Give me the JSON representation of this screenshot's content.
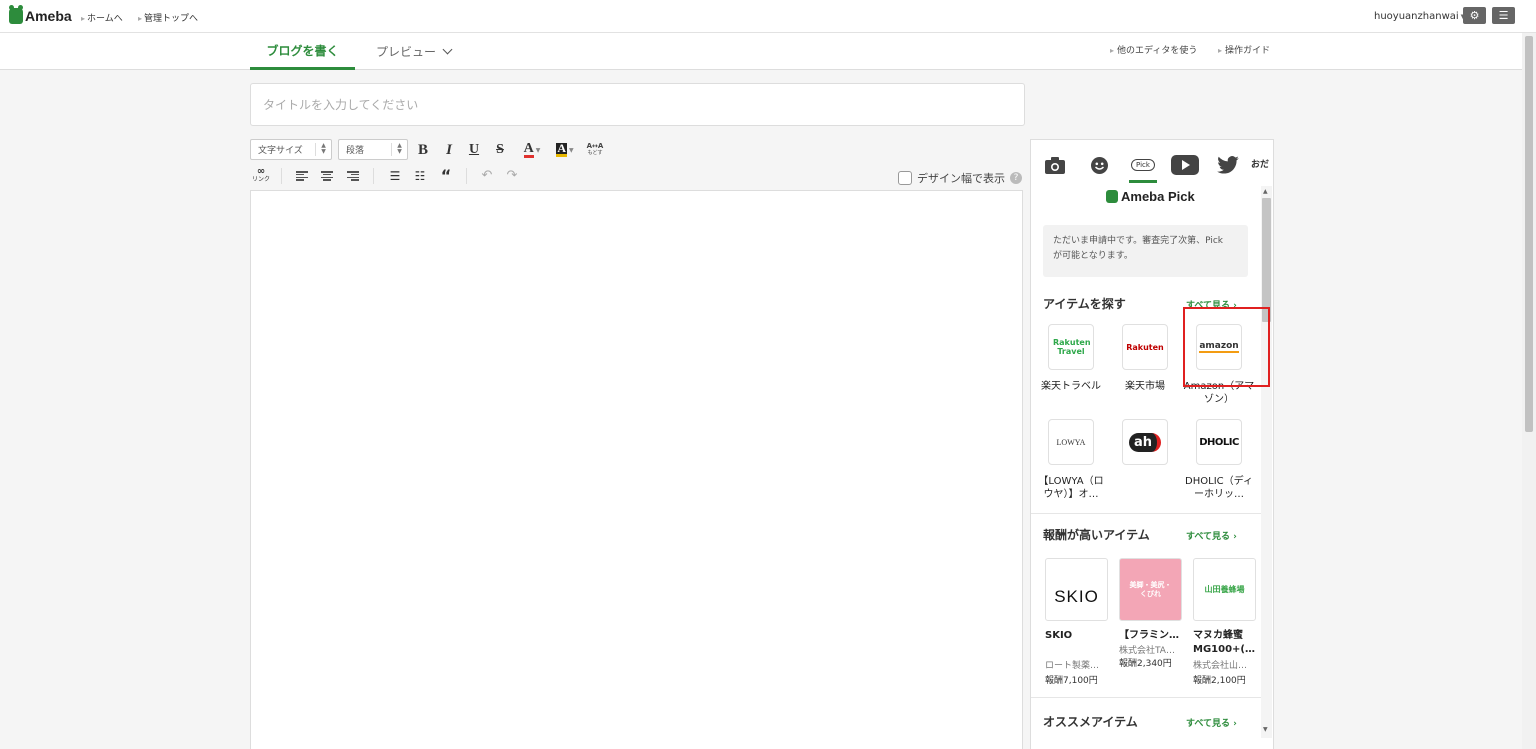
{
  "topbar": {
    "logo": "Ameba",
    "links": [
      "ホームへ",
      "管理トップへ"
    ],
    "username": "huoyuanzhanwai"
  },
  "tabs": {
    "write": "ブログを書く",
    "preview": "プレビュー",
    "right_links": [
      "他のエディタを使う",
      "操作ガイド"
    ]
  },
  "title_input": {
    "placeholder": "タイトルを入力してください",
    "value": ""
  },
  "toolbar": {
    "font_size": "文字サイズ",
    "paragraph": "段落",
    "bold": "B",
    "italic": "I",
    "underline": "U",
    "strike": "S",
    "font_color": "A",
    "bg_color": "A",
    "link_label": "リンク",
    "design_width": "デザイン幅で表示"
  },
  "colors": {
    "accent": "#2d8c3c",
    "highlight": "#e02020"
  },
  "panel": {
    "pick_title": "Ameba Pick",
    "pick_badge": "Pick",
    "tab_more": "おだ",
    "notice": "ただいま申請中です。審査完了次第、Pick\nが可能となります。",
    "search_section": {
      "title": "アイテムを探す",
      "see_all": "すべて見る",
      "items": [
        {
          "logo": "Rakuten Travel",
          "label": "楽天トラベル"
        },
        {
          "logo": "Rakuten",
          "label": "楽天市場"
        },
        {
          "logo": "amazon",
          "label": "Amazon（アマゾン）"
        },
        {
          "logo": "LOWYA",
          "label": "【LOWYA（ロウヤ）】オ…"
        },
        {
          "logo": "ah",
          "label": ""
        },
        {
          "logo": "DHOLIC",
          "label": "DHOLIC（ディーホリッ…"
        }
      ]
    },
    "reward_section": {
      "title": "報酬が高いアイテム",
      "see_all": "すべて見る",
      "items": [
        {
          "image_text": "SKIO",
          "name": "SKIO",
          "name2": "",
          "company": "ロート製薬…",
          "reward": "報酬7,100円"
        },
        {
          "image_text": "美脚・美尻・くびれ",
          "name": "【フラミン…",
          "name2": "",
          "company": "株式会社TA…",
          "reward": "報酬2,340円"
        },
        {
          "image_text": "山田養蜂場",
          "name": "マヌカ蜂蜜",
          "name2": "MG100+(…",
          "company": "株式会社山…",
          "reward": "報酬2,100円"
        }
      ]
    },
    "recommend_section": {
      "title": "オススメアイテム",
      "see_all": "すべて見る"
    }
  }
}
